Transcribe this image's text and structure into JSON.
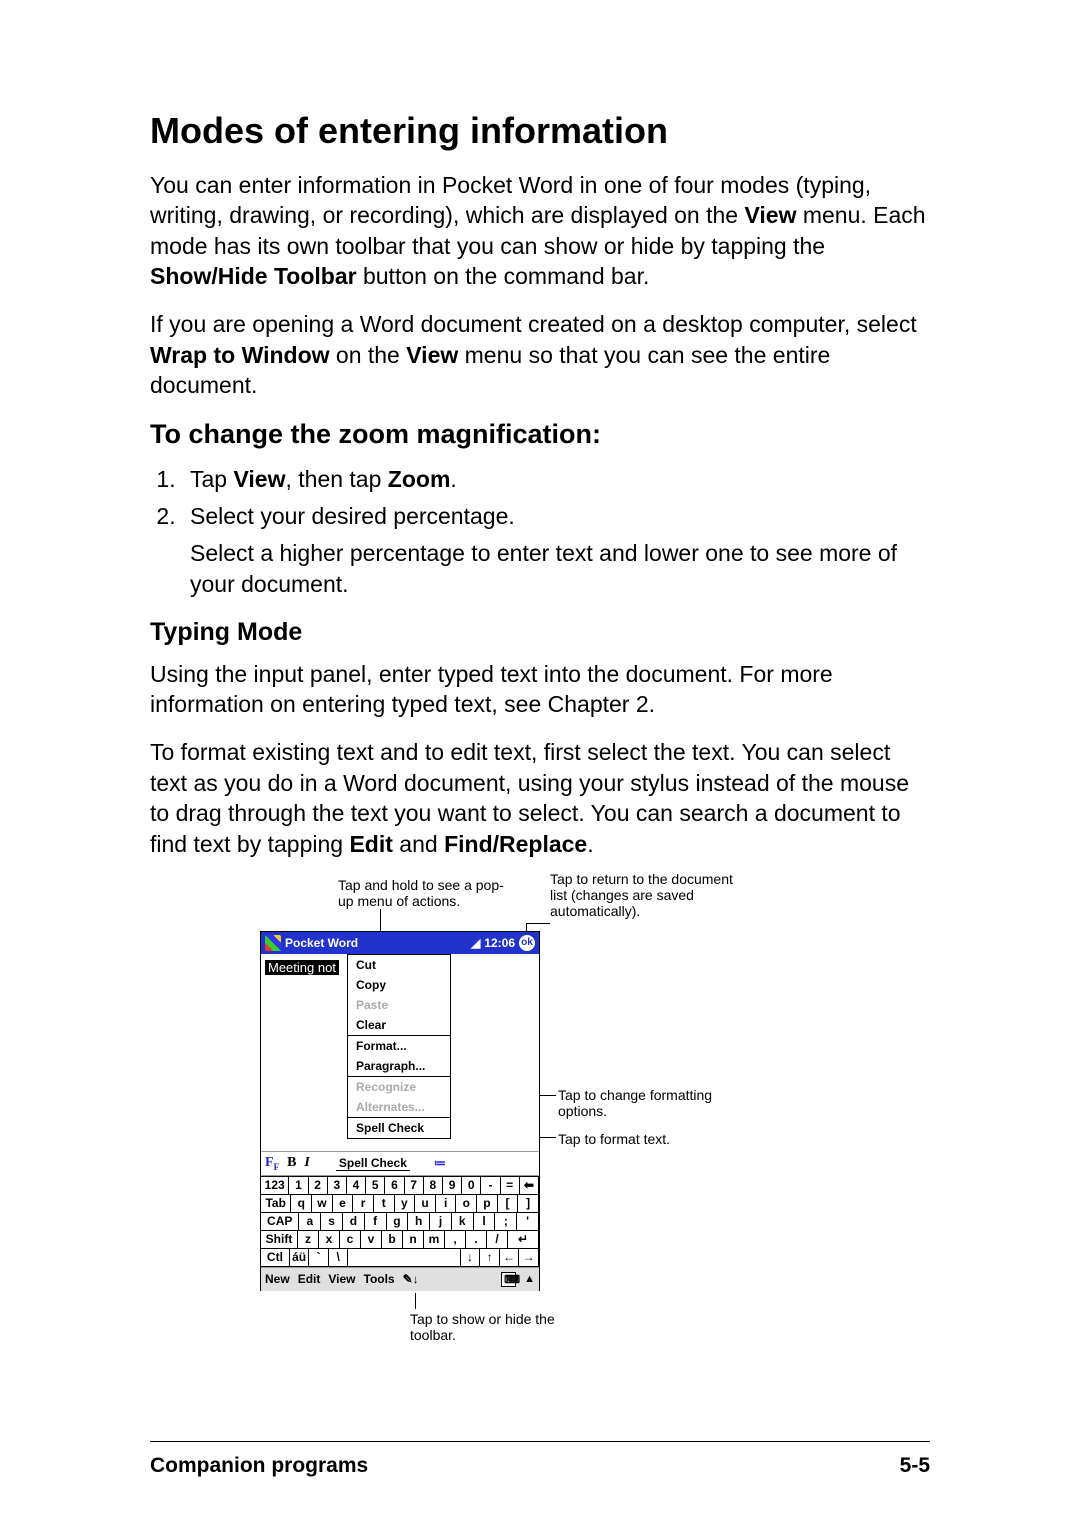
{
  "heading": "Modes of entering information",
  "p1_a": "You can enter information in Pocket Word in one of four modes (typing, writing, drawing, or recording), which are displayed on the ",
  "p1_b": "View",
  "p1_c": " menu. Each mode has its own toolbar that you can show or hide by tapping the ",
  "p1_d": "Show/Hide Toolbar",
  "p1_e": " button on the command bar.",
  "p2_a": "If you are opening a Word document created on a desktop computer, select ",
  "p2_b": "Wrap to Window",
  "p2_c": " on the ",
  "p2_d": "View",
  "p2_e": " menu so that you can see the entire document.",
  "h2": "To change the zoom magnification:",
  "step1_a": "Tap ",
  "step1_b": "View",
  "step1_c": ", then tap ",
  "step1_d": "Zoom",
  "step1_e": ".",
  "step2": "Select your desired percentage.",
  "step2_note": "Select a higher percentage to enter text and lower one to see more of your document.",
  "h3": "Typing Mode",
  "p3": "Using the input panel, enter typed text into the document. For more information on entering typed text, see Chapter 2.",
  "p4_a": "To format existing text and to edit text, first select the text. You can select text as you do in a Word document, using your stylus instead of the mouse to drag through the text you want to select. You can search a document to find text by tapping ",
  "p4_b": "Edit",
  "p4_c": " and ",
  "p4_d": "Find/Replace",
  "p4_e": ".",
  "callouts": {
    "c1": "Tap and hold to see a pop-up menu of actions.",
    "c2": "Tap to return to the document list (changes are saved automatically).",
    "c3": "Tap to change formatting options.",
    "c4": "Tap to format text.",
    "c5": "Tap to show or hide the toolbar."
  },
  "device": {
    "title": "Pocket Word",
    "time": "12:06",
    "ok": "ok",
    "seltext": "Meeting not",
    "menu": {
      "cut": "Cut",
      "copy": "Copy",
      "paste": "Paste",
      "clear": "Clear",
      "format": "Format...",
      "paragraph": "Paragraph...",
      "recognize": "Recognize",
      "alternates": "Alternates...",
      "spellcheck": "Spell Check"
    },
    "fmt": {
      "F": "F",
      "B": "B",
      "I": "I",
      "bullets": "≔"
    },
    "kbd": {
      "r1": [
        "123",
        "1",
        "2",
        "3",
        "4",
        "5",
        "6",
        "7",
        "8",
        "9",
        "0",
        "-",
        "=",
        "⬅"
      ],
      "r2": [
        "Tab",
        "q",
        "w",
        "e",
        "r",
        "t",
        "y",
        "u",
        "i",
        "o",
        "p",
        "[",
        "]"
      ],
      "r3": [
        "CAP",
        "a",
        "s",
        "d",
        "f",
        "g",
        "h",
        "j",
        "k",
        "l",
        ";",
        "'"
      ],
      "r4": [
        "Shift",
        "z",
        "x",
        "c",
        "v",
        "b",
        "n",
        "m",
        ",",
        ".",
        "/",
        "↵"
      ],
      "r5": [
        "Ctl",
        "áü",
        "`",
        "\\",
        " ",
        "↓",
        "↑",
        "←",
        "→"
      ]
    },
    "menubar": {
      "new": "New",
      "edit": "Edit",
      "view": "View",
      "tools": "Tools",
      "pen": "✎↓",
      "panelup": "▲"
    }
  },
  "footer": {
    "left": "Companion programs",
    "right": "5-5"
  }
}
